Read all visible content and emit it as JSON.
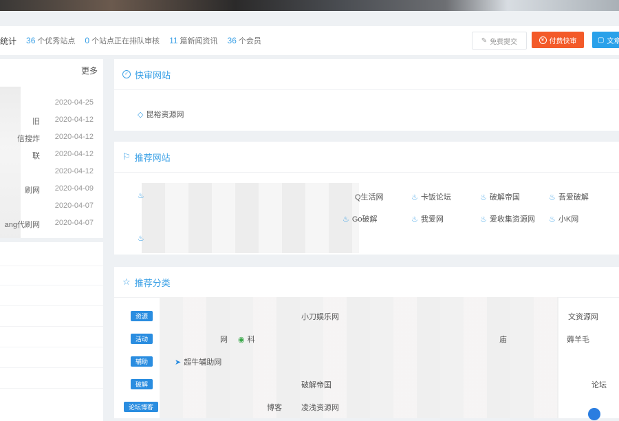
{
  "stats": {
    "title": "统计",
    "items": [
      {
        "num": "36",
        "label": "个优秀站点"
      },
      {
        "num": "0",
        "label": "个站点正在排队审核"
      },
      {
        "num": "11",
        "label": "篇新闻资讯"
      },
      {
        "num": "36",
        "label": "个会员"
      }
    ],
    "buttons": {
      "submit": "免费提交",
      "paid": "付费快审",
      "article": "文章"
    }
  },
  "news": {
    "more": "更多",
    "items": [
      {
        "title": "",
        "date": "2020-04-25"
      },
      {
        "title": "旧",
        "date": "2020-04-12"
      },
      {
        "title": "信搜炸",
        "date": "2020-04-12"
      },
      {
        "title": "联",
        "date": "2020-04-12"
      },
      {
        "title": "",
        "date": "2020-04-12"
      },
      {
        "title": "刷网",
        "date": "2020-04-09"
      },
      {
        "title": "",
        "date": "2020-04-07"
      },
      {
        "title": "ang代刷网",
        "date": "2020-04-07"
      }
    ]
  },
  "kuaishen": {
    "title": "快审网站",
    "sites": [
      "昆裕资源网"
    ]
  },
  "tuijian": {
    "title": "推荐网站",
    "sites": [
      "Q生活网",
      "卡饭论坛",
      "破解帝国",
      "吾爱破解",
      "Go破解",
      "我爱网",
      "爱收集资源网",
      "小K网",
      "",
      "\u0002"
    ]
  },
  "fenlei": {
    "title": "推荐分类",
    "tags": [
      "资源",
      "活动",
      "辅助",
      "破解",
      "论坛博客"
    ],
    "sites": [
      "小刀娱乐网",
      "文资源网",
      "网",
      "科",
      "庙",
      "薅羊毛",
      "超牛辅助网",
      "破解帝国",
      "论坛",
      "凌浅资源网",
      "博客"
    ]
  },
  "colors": {
    "accent": "#3aa0e6",
    "paid": "#f35a29",
    "tag": "#2a8de0"
  },
  "icons": [
    "pencil-icon",
    "coin-icon",
    "doc-icon",
    "shield-icon",
    "flag-icon",
    "star-icon",
    "diamond-icon",
    "fire-icon"
  ]
}
